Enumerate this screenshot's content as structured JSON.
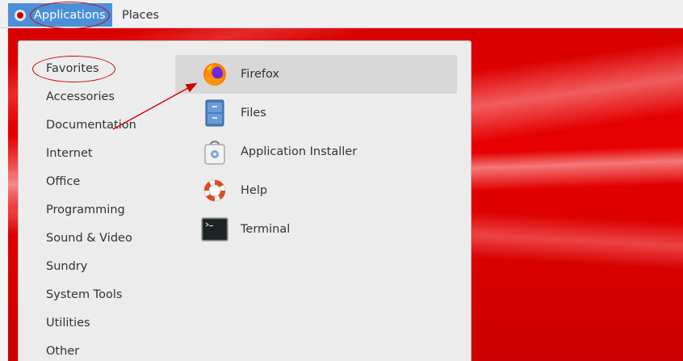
{
  "topbar": {
    "applications_label": "Applications",
    "places_label": "Places"
  },
  "categories": [
    "Favorites",
    "Accessories",
    "Documentation",
    "Internet",
    "Office",
    "Programming",
    "Sound & Video",
    "Sundry",
    "System Tools",
    "Utilities",
    "Other"
  ],
  "apps": [
    {
      "label": "Firefox",
      "icon": "firefox-icon"
    },
    {
      "label": "Files",
      "icon": "files-icon"
    },
    {
      "label": "Application Installer",
      "icon": "application-installer-icon"
    },
    {
      "label": "Help",
      "icon": "help-icon"
    },
    {
      "label": "Terminal",
      "icon": "terminal-icon"
    }
  ],
  "colors": {
    "accent": "#4a90d9",
    "annotation": "#d00000",
    "desktop": "#d40000"
  }
}
